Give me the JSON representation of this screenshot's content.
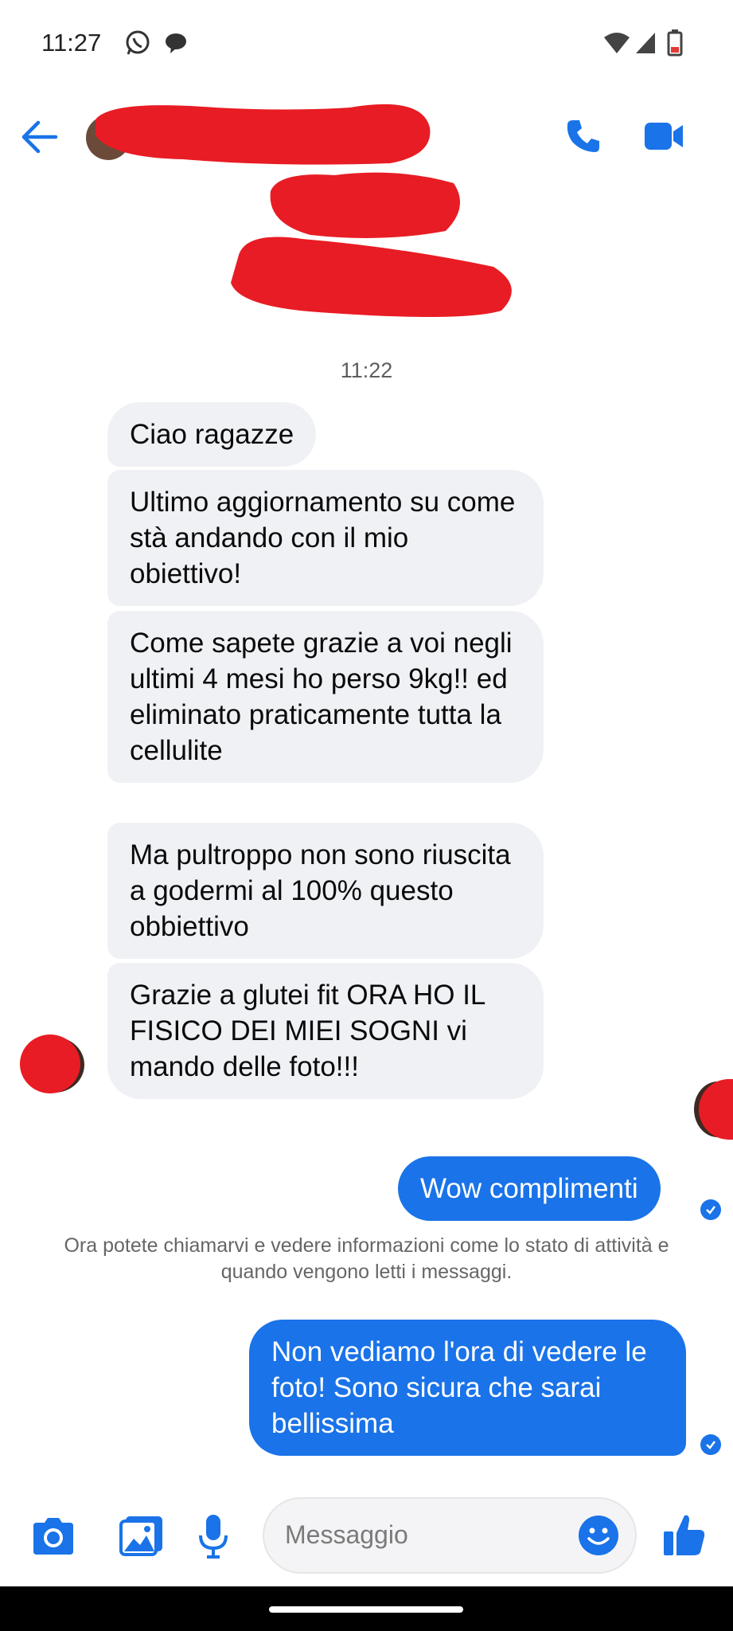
{
  "status_bar": {
    "time": "11:27"
  },
  "header": {
    "contact_name_redacted": "",
    "back_icon": "arrow-left-icon",
    "call_icon": "phone-icon",
    "video_icon": "video-camera-icon",
    "accent_color": "#1a73e8"
  },
  "thread": {
    "timestamp": "11:22",
    "incoming": [
      "Ciao ragazze",
      "Ultimo aggiornamento su come stà andando con il mio obiettivo!",
      "Come sapete grazie a voi negli ultimi 4 mesi ho perso 9kg!! ed eliminato praticamente tutta la cellulite",
      "Ma pultroppo non sono riuscita a godermi al 100% questo obbiettivo",
      "Grazie a glutei fit ORA HO IL FISICO DEI MIEI SOGNI vi mando delle foto!!!"
    ],
    "outgoing_1": "Wow complimenti",
    "notice": "Ora potete chiamarvi e vedere informazioni come lo stato di attività e quando vengono letti i messaggi.",
    "outgoing_2": "Non vediamo l'ora di vedere le foto! Sono sicura che sarai bellissima"
  },
  "composer": {
    "placeholder": "Messaggio",
    "icons": [
      "camera-icon",
      "gallery-icon",
      "microphone-icon",
      "emoji-icon",
      "thumbs-up-icon"
    ]
  }
}
